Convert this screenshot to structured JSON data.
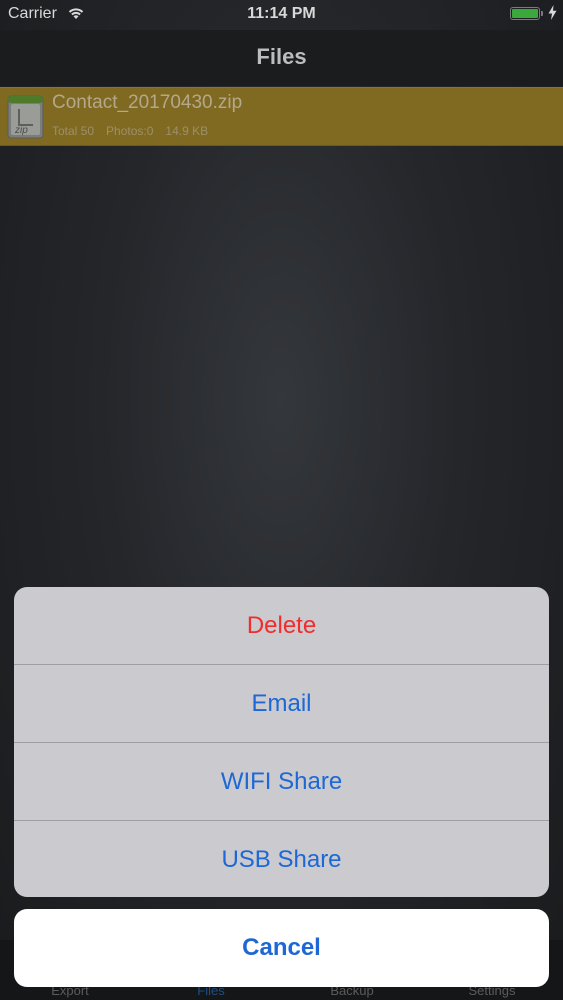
{
  "status_bar": {
    "carrier": "Carrier",
    "time": "11:14 PM",
    "battery_color": "#3aa83a",
    "icons": [
      "wifi-icon",
      "battery-icon",
      "charging-icon"
    ]
  },
  "nav": {
    "title": "Files"
  },
  "files": [
    {
      "icon": "zip-file-icon",
      "name": "Contact_20170430.zip",
      "total": "Total 50",
      "photos": "Photos:0",
      "size": "14.9 KB",
      "highlight_color": "#806a22"
    }
  ],
  "action_sheet": {
    "actions": [
      {
        "label": "Delete",
        "style": "destructive",
        "color": "#f02c2c"
      },
      {
        "label": "Email",
        "style": "default",
        "color": "#1d67d6"
      },
      {
        "label": "WIFI Share",
        "style": "default",
        "color": "#1d67d6"
      },
      {
        "label": "USB Share",
        "style": "default",
        "color": "#1d67d6"
      }
    ],
    "cancel_label": "Cancel"
  },
  "tab_bar": {
    "tabs": [
      {
        "label": "Export",
        "active": false
      },
      {
        "label": "Files",
        "active": true
      },
      {
        "label": "Backup",
        "active": false
      },
      {
        "label": "Settings",
        "active": false
      }
    ],
    "active_color": "#1c4f86"
  }
}
